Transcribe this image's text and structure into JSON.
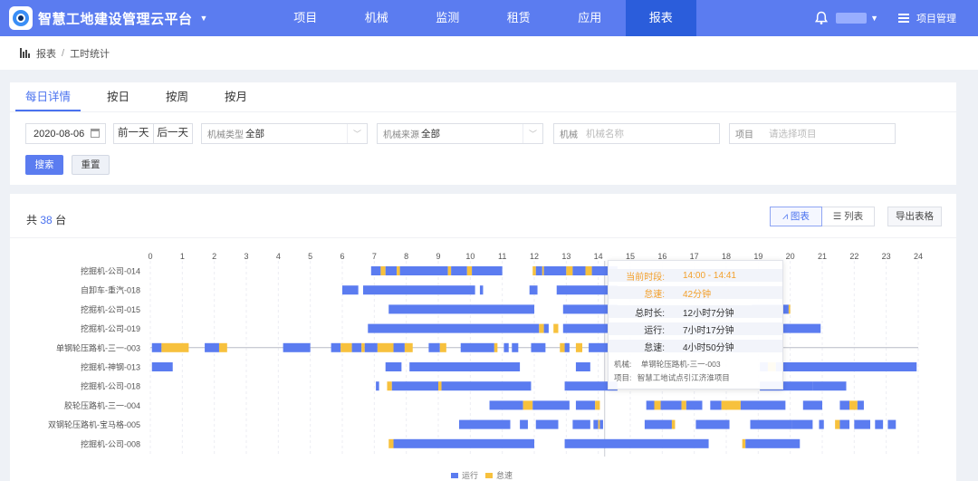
{
  "app": {
    "title": "智慧工地建设管理云平台"
  },
  "nav": {
    "items": [
      "项目",
      "机械",
      "监测",
      "租赁",
      "应用",
      "报表"
    ],
    "active": "报表"
  },
  "topright": {
    "menu_label": "项目管理"
  },
  "breadcrumb": {
    "root": "报表",
    "current": "工时统计"
  },
  "tabs": [
    "每日详情",
    "按日",
    "按周",
    "按月"
  ],
  "filters": {
    "date": "2020-08-06",
    "prev_day": "前一天",
    "next_day": "后一天",
    "machine_type_label": "机械类型",
    "machine_type_value": "全部",
    "machine_source_label": "机械来源",
    "machine_source_value": "全部",
    "machine_label": "机械",
    "machine_placeholder": "机械名称",
    "project_label": "项目",
    "project_placeholder": "请选择项目",
    "search": "搜索",
    "reset": "重置"
  },
  "summary": {
    "prefix": "共",
    "count": "38",
    "suffix": "台"
  },
  "toolbar": {
    "chart": "图表",
    "list": "列表",
    "export": "导出表格"
  },
  "colors": {
    "run": "#5b7cf0",
    "idle": "#f7c13d",
    "nav": "#5b7cf0",
    "nav_active": "#2b5ddb"
  },
  "chart_data": {
    "type": "gantt",
    "x_ticks": [
      0,
      1,
      2,
      3,
      4,
      5,
      6,
      7,
      8,
      9,
      10,
      11,
      12,
      13,
      14,
      15,
      16,
      17,
      18,
      19,
      20,
      21,
      22,
      23,
      24
    ],
    "xlim": [
      0,
      24
    ],
    "grid": true,
    "legend": {
      "placement": "bottom-center",
      "items": [
        {
          "name": "运行",
          "color": "#5b7cf0"
        },
        {
          "name": "怠速",
          "color": "#f7c13d"
        }
      ]
    },
    "rows": [
      {
        "name": "挖掘机-公司-014",
        "segments": [
          [
            6.9,
            7.2,
            "run"
          ],
          [
            7.2,
            7.35,
            "idle"
          ],
          [
            7.35,
            7.7,
            "run"
          ],
          [
            7.7,
            7.8,
            "idle"
          ],
          [
            7.8,
            9.3,
            "run"
          ],
          [
            9.3,
            9.4,
            "idle"
          ],
          [
            9.4,
            9.9,
            "run"
          ],
          [
            9.9,
            10.05,
            "idle"
          ],
          [
            10.05,
            11.0,
            "run"
          ],
          [
            11.95,
            12.05,
            "idle"
          ],
          [
            12.05,
            12.25,
            "run"
          ],
          [
            12.25,
            12.3,
            "idle"
          ],
          [
            12.3,
            13.0,
            "run"
          ],
          [
            13.0,
            13.2,
            "idle"
          ],
          [
            13.2,
            13.6,
            "run"
          ],
          [
            13.6,
            13.8,
            "idle"
          ],
          [
            13.8,
            14.6,
            "run"
          ]
        ]
      },
      {
        "name": "自卸车-重汽-018",
        "segments": [
          [
            6.0,
            6.5,
            "run"
          ],
          [
            6.65,
            10.15,
            "run"
          ],
          [
            10.3,
            10.4,
            "run"
          ],
          [
            11.85,
            12.1,
            "run"
          ],
          [
            12.7,
            14.6,
            "run"
          ]
        ]
      },
      {
        "name": "挖掘机-公司-015",
        "segments": [
          [
            7.45,
            12.0,
            "run"
          ],
          [
            12.9,
            14.6,
            "run"
          ],
          [
            18.8,
            19.95,
            "run"
          ],
          [
            19.95,
            20.0,
            "idle"
          ]
        ]
      },
      {
        "name": "挖掘机-公司-019",
        "segments": [
          [
            6.8,
            12.15,
            "run"
          ],
          [
            12.15,
            12.3,
            "idle"
          ],
          [
            12.3,
            12.45,
            "run"
          ],
          [
            12.6,
            12.75,
            "idle"
          ],
          [
            12.9,
            14.6,
            "run"
          ],
          [
            18.9,
            20.95,
            "run"
          ]
        ]
      },
      {
        "name": "单钢轮压路机-三一-003",
        "segments": [
          [
            0.05,
            0.35,
            "run"
          ],
          [
            0.35,
            1.2,
            "idle"
          ],
          [
            1.7,
            2.15,
            "run"
          ],
          [
            2.15,
            2.4,
            "idle"
          ],
          [
            4.15,
            5.0,
            "run"
          ],
          [
            5.65,
            5.95,
            "run"
          ],
          [
            5.95,
            6.3,
            "idle"
          ],
          [
            6.3,
            6.6,
            "run"
          ],
          [
            6.6,
            6.7,
            "idle"
          ],
          [
            6.7,
            7.1,
            "run"
          ],
          [
            7.1,
            7.6,
            "idle"
          ],
          [
            7.6,
            7.95,
            "run"
          ],
          [
            7.95,
            8.2,
            "idle"
          ],
          [
            8.7,
            9.05,
            "run"
          ],
          [
            9.05,
            9.25,
            "idle"
          ],
          [
            9.7,
            10.75,
            "run"
          ],
          [
            10.75,
            10.85,
            "idle"
          ],
          [
            11.05,
            11.2,
            "run"
          ],
          [
            11.3,
            11.5,
            "run"
          ],
          [
            11.9,
            12.35,
            "run"
          ],
          [
            12.8,
            12.95,
            "idle"
          ],
          [
            12.95,
            13.1,
            "run"
          ],
          [
            13.3,
            13.5,
            "idle"
          ],
          [
            13.7,
            14.6,
            "run"
          ],
          [
            18.4,
            18.7,
            "run"
          ],
          [
            18.9,
            19.3,
            "run"
          ]
        ]
      },
      {
        "name": "挖掘机-神钢-013",
        "segments": [
          [
            0.05,
            0.7,
            "run"
          ],
          [
            7.35,
            7.85,
            "run"
          ],
          [
            8.1,
            11.55,
            "run"
          ],
          [
            13.3,
            13.75,
            "run"
          ],
          [
            19.05,
            19.3,
            "run"
          ],
          [
            19.3,
            19.55,
            "idle"
          ],
          [
            19.55,
            23.95,
            "run"
          ]
        ]
      },
      {
        "name": "挖掘机-公司-018",
        "segments": [
          [
            7.05,
            7.15,
            "run"
          ],
          [
            7.4,
            7.55,
            "idle"
          ],
          [
            7.55,
            9.0,
            "run"
          ],
          [
            9.0,
            9.1,
            "idle"
          ],
          [
            9.1,
            11.9,
            "run"
          ],
          [
            12.95,
            14.6,
            "run"
          ],
          [
            19.05,
            20.7,
            "run"
          ],
          [
            20.7,
            21.75,
            "run"
          ]
        ]
      },
      {
        "name": "胶轮压路机-三一-004",
        "segments": [
          [
            10.6,
            11.65,
            "run"
          ],
          [
            11.65,
            11.95,
            "idle"
          ],
          [
            11.95,
            13.1,
            "run"
          ],
          [
            13.3,
            13.9,
            "run"
          ],
          [
            13.9,
            14.05,
            "idle"
          ],
          [
            15.5,
            15.75,
            "run"
          ],
          [
            15.75,
            15.95,
            "idle"
          ],
          [
            15.95,
            16.6,
            "run"
          ],
          [
            16.6,
            16.75,
            "idle"
          ],
          [
            16.75,
            17.25,
            "run"
          ],
          [
            17.5,
            17.85,
            "run"
          ],
          [
            17.85,
            18.45,
            "idle"
          ],
          [
            18.45,
            19.85,
            "run"
          ],
          [
            20.4,
            21.0,
            "run"
          ],
          [
            21.55,
            21.85,
            "run"
          ],
          [
            21.85,
            22.1,
            "idle"
          ],
          [
            22.1,
            22.3,
            "run"
          ]
        ]
      },
      {
        "name": "双钢轮压路机-宝马格-005",
        "segments": [
          [
            9.65,
            11.25,
            "run"
          ],
          [
            11.55,
            11.8,
            "run"
          ],
          [
            12.05,
            12.75,
            "run"
          ],
          [
            13.2,
            13.75,
            "run"
          ],
          [
            13.85,
            14.0,
            "run"
          ],
          [
            14.0,
            14.05,
            "idle"
          ],
          [
            14.05,
            14.15,
            "run"
          ],
          [
            15.45,
            16.3,
            "run"
          ],
          [
            16.3,
            16.4,
            "idle"
          ],
          [
            17.05,
            18.1,
            "run"
          ],
          [
            18.75,
            20.05,
            "run"
          ],
          [
            20.05,
            20.7,
            "run"
          ],
          [
            20.9,
            21.05,
            "run"
          ],
          [
            21.4,
            21.55,
            "idle"
          ],
          [
            21.55,
            21.85,
            "run"
          ],
          [
            22.0,
            22.5,
            "run"
          ],
          [
            22.65,
            22.9,
            "run"
          ],
          [
            23.05,
            23.3,
            "run"
          ]
        ]
      },
      {
        "name": "挖掘机-公司-008",
        "segments": [
          [
            7.45,
            7.6,
            "idle"
          ],
          [
            7.6,
            12.0,
            "run"
          ],
          [
            12.95,
            17.45,
            "run"
          ],
          [
            18.5,
            18.6,
            "idle"
          ],
          [
            18.6,
            20.3,
            "run"
          ]
        ]
      }
    ],
    "hover_x": 14.2
  },
  "tooltip": {
    "period_label": "当前时段:",
    "period_value": "14:00 - 14:41",
    "status_label": "怠速:",
    "status_value": "42分钟",
    "total_label": "总时长:",
    "total_value": "12小时7分钟",
    "run_label": "运行:",
    "run_value": "7小时17分钟",
    "idle_label": "怠速:",
    "idle_value": "4小时50分钟",
    "machine_label": "机械:",
    "machine_value": "单钢轮压路机-三一-003",
    "project_label": "项目:",
    "project_value": "智慧工地试点引江济淮项目"
  }
}
